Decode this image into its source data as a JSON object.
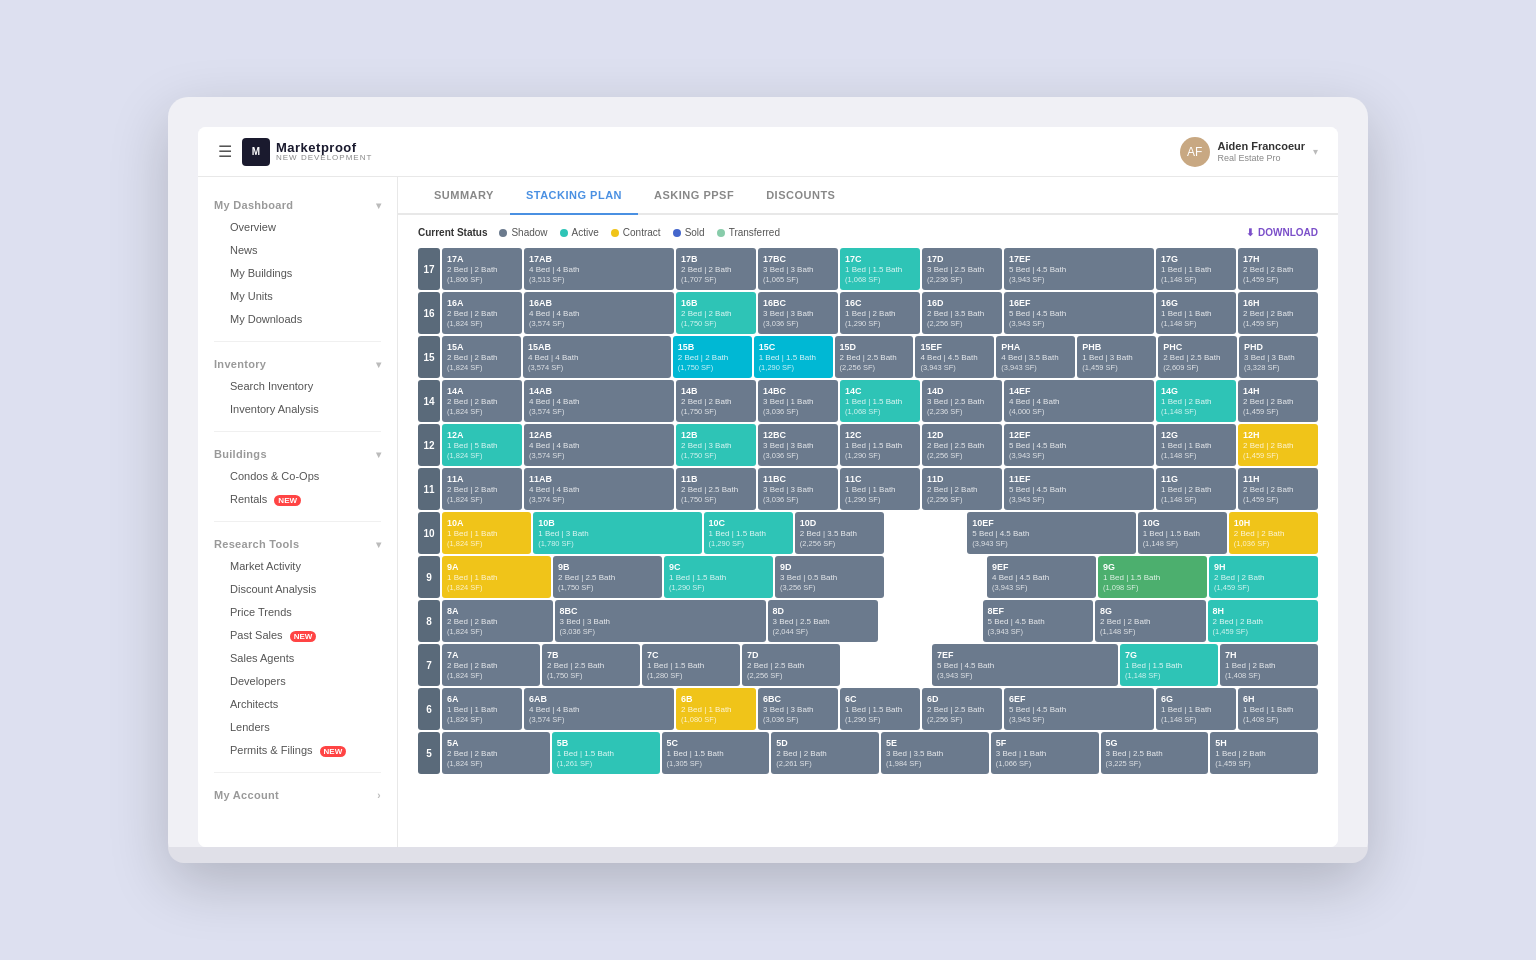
{
  "header": {
    "menu_icon": "☰",
    "logo_name": "Marketproof",
    "logo_sub": "NEW DEVELOPMENT",
    "user_name": "Aiden Francoeur",
    "user_role": "Real Estate Pro"
  },
  "sidebar": {
    "my_dashboard_label": "My Dashboard",
    "items_dashboard": [
      "Overview",
      "News",
      "My Buildings",
      "My Units",
      "My Downloads"
    ],
    "inventory_label": "Inventory",
    "items_inventory": [
      "Search Inventory",
      "Inventory Analysis"
    ],
    "buildings_label": "Buildings",
    "items_buildings": [
      "Condos & Co-Ops",
      "Rentals"
    ],
    "research_tools_label": "Research Tools",
    "items_research": [
      "Market Activity",
      "Discount Analysis",
      "Price Trends",
      "Past Sales",
      "Sales Agents",
      "Developers",
      "Architects",
      "Lenders",
      "Permits & Filings"
    ],
    "my_account_label": "My Account"
  },
  "tabs": [
    "SUMMARY",
    "STACKING PLAN",
    "ASKING PPSF",
    "DISCOUNTS"
  ],
  "active_tab": "STACKING PLAN",
  "status_label": "Current Status",
  "legend": [
    {
      "label": "Shadow",
      "color": "#6b7a8d"
    },
    {
      "label": "Active",
      "color": "#2ec4b6"
    },
    {
      "label": "Contract",
      "color": "#f0c419"
    },
    {
      "label": "Sold",
      "color": "#4466cc"
    },
    {
      "label": "Transferred",
      "color": "#aaddcc"
    }
  ],
  "download_label": "DOWNLOAD"
}
